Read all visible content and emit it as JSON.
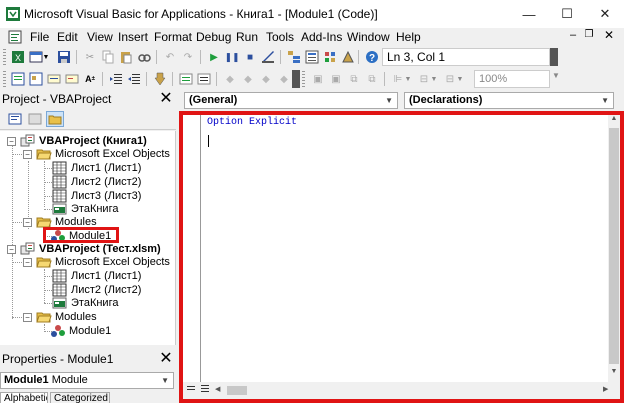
{
  "window": {
    "title": "Microsoft Visual Basic for Applications - Книга1 - [Module1 (Code)]",
    "minimize": "—",
    "maximize": "☐",
    "close": "✕"
  },
  "menu": {
    "items": [
      {
        "label": "File",
        "underline": "F"
      },
      {
        "label": "Edit"
      },
      {
        "label": "View"
      },
      {
        "label": "Insert"
      },
      {
        "label": "Format"
      },
      {
        "label": "Debug"
      },
      {
        "label": "Run"
      },
      {
        "label": "Tools"
      },
      {
        "label": "Add-Ins"
      },
      {
        "label": "Window"
      },
      {
        "label": "Help"
      }
    ],
    "doc_minimize": "–",
    "doc_restore": "❐",
    "doc_close": "✕"
  },
  "toolbar": {
    "position": "Ln 3, Col 1",
    "zoom": "100%"
  },
  "project_explorer": {
    "title": "Project - VBAProject",
    "close": "✕",
    "tree": [
      {
        "label": "VBAProject (Книга1)",
        "bold": true,
        "type": "project"
      },
      {
        "label": "Microsoft Excel Objects",
        "type": "folder"
      },
      {
        "label": "Лист1 (Лист1)",
        "type": "sheet"
      },
      {
        "label": "Лист2 (Лист2)",
        "type": "sheet"
      },
      {
        "label": "Лист3 (Лист3)",
        "type": "sheet"
      },
      {
        "label": "ЭтаКнига",
        "type": "workbook"
      },
      {
        "label": "Modules",
        "type": "folder"
      },
      {
        "label": "Module1",
        "type": "module",
        "selected": true
      },
      {
        "label": "VBAProject (Тест.xlsm)",
        "bold": true,
        "type": "project"
      },
      {
        "label": "Microsoft Excel Objects",
        "type": "folder"
      },
      {
        "label": "Лист1 (Лист1)",
        "type": "sheet"
      },
      {
        "label": "Лист2 (Лист2)",
        "type": "sheet"
      },
      {
        "label": "ЭтаКнига",
        "type": "workbook"
      },
      {
        "label": "Modules",
        "type": "folder"
      },
      {
        "label": "Module1",
        "type": "module"
      }
    ]
  },
  "properties": {
    "title": "Properties - Module1",
    "close": "✕",
    "object_name": "Module1",
    "object_type": "Module",
    "tabs": [
      "Alphabetic",
      "Categorized"
    ]
  },
  "code_window": {
    "object_combo": "(General)",
    "procedure_combo": "(Declarations)",
    "code": "Option Explicit"
  },
  "colors": {
    "highlight_border": "#e01414",
    "keyword_blue": "#0000c8"
  }
}
